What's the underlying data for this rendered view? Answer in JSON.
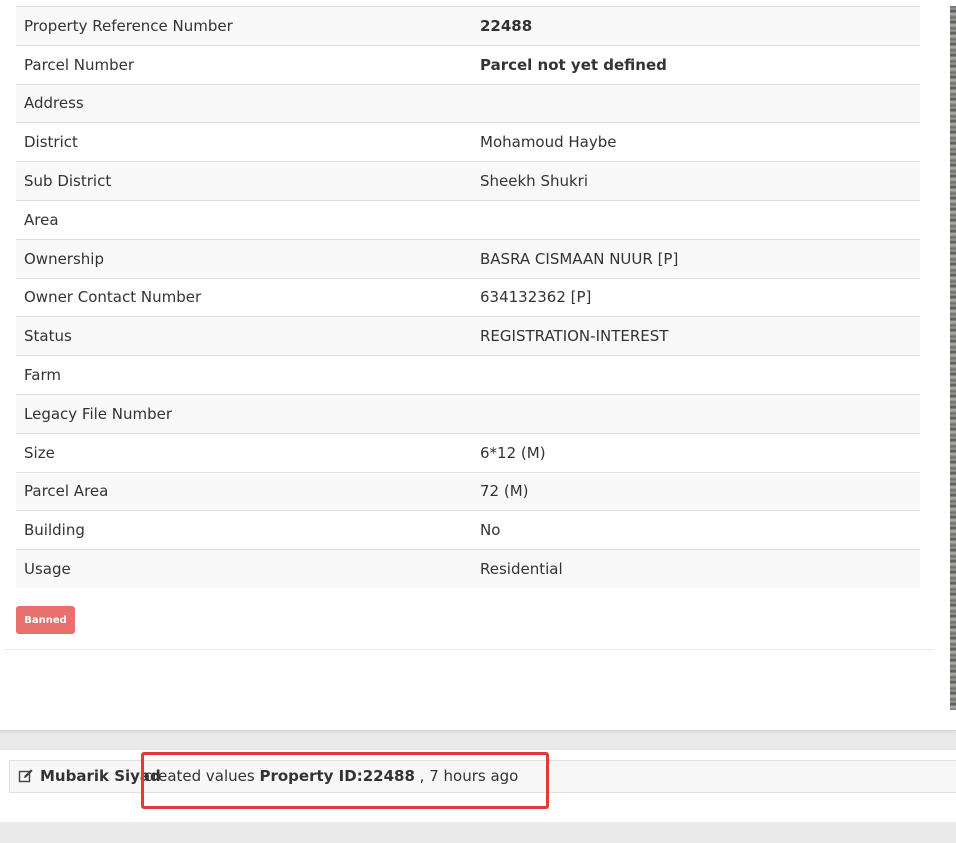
{
  "details": {
    "rows": [
      {
        "label": "Property Reference Number",
        "value": "22488",
        "bold": true
      },
      {
        "label": "Parcel Number",
        "value": "Parcel not yet defined",
        "bold": true
      },
      {
        "label": "Address",
        "value": "",
        "bold": false
      },
      {
        "label": "District",
        "value": "Mohamoud Haybe",
        "bold": false
      },
      {
        "label": "Sub District",
        "value": "Sheekh Shukri",
        "bold": false
      },
      {
        "label": "Area",
        "value": "",
        "bold": false
      },
      {
        "label": "Ownership",
        "value": "BASRA CISMAAN NUUR [P]",
        "bold": false
      },
      {
        "label": "Owner Contact Number",
        "value": "634132362 [P]",
        "bold": false
      },
      {
        "label": "Status",
        "value": "REGISTRATION-INTEREST",
        "bold": false
      },
      {
        "label": "Farm",
        "value": "",
        "bold": false
      },
      {
        "label": "Legacy File Number",
        "value": "",
        "bold": false
      },
      {
        "label": "Size",
        "value": "6*12 (M)",
        "bold": false
      },
      {
        "label": "Parcel Area",
        "value": "72 (M)",
        "bold": false
      },
      {
        "label": "Building",
        "value": "No",
        "bold": false
      },
      {
        "label": "Usage",
        "value": "Residential",
        "bold": false
      }
    ]
  },
  "status_button": {
    "label": "Banned",
    "color": "#e76f6c"
  },
  "activity": {
    "icon": "edit-icon",
    "user": "Mubarik Siyad",
    "action": "created values",
    "target": "Property ID:22488",
    "time": ", 7 hours ago"
  },
  "highlight_color": "#e53939"
}
